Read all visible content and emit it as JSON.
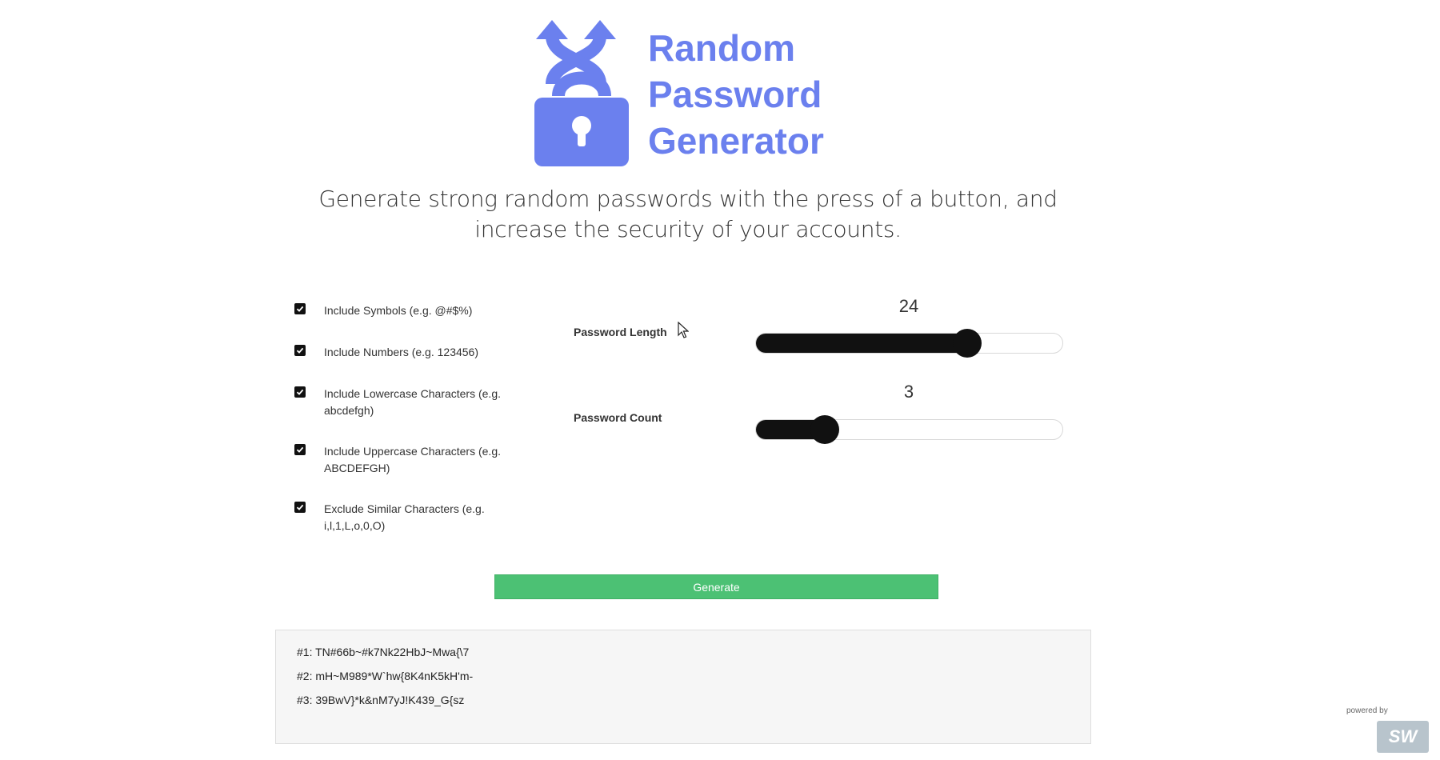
{
  "logo": {
    "line1": "Random",
    "line2": "Password",
    "line3": "Generator",
    "icon": "lock-shuffle-icon",
    "color": "#6b80ee"
  },
  "tagline": "Generate strong random passwords with the press of a button, and increase the security of your accounts.",
  "options": [
    {
      "label": "Include Symbols (e.g. @#$%)",
      "checked": true
    },
    {
      "label": "Include Numbers (e.g. 123456)",
      "checked": true
    },
    {
      "label": "Include Lowercase Characters (e.g. abcdefgh)",
      "checked": true
    },
    {
      "label": "Include Uppercase Characters (e.g. ABCDEFGH)",
      "checked": true
    },
    {
      "label": "Exclude Similar Characters (e.g. i,l,1,L,o,0,O)",
      "checked": true
    }
  ],
  "sliders": {
    "length": {
      "label": "Password Length",
      "value": "24",
      "fraction": 0.69
    },
    "count": {
      "label": "Password Count",
      "value": "3",
      "fraction": 0.225
    }
  },
  "generate_label": "Generate",
  "results": [
    "#1: TN#66b~#k7Nk22HbJ~Mwa{\\7",
    "#2: mH~M989*W`hw{8K4nK5kH'm-",
    "#3: 39BwV}*k&nM7yJ!K439_G{sz"
  ],
  "footer": {
    "powered_by": "powered by",
    "badge": "SW"
  },
  "colors": {
    "accent": "#6b80ee",
    "generate": "#4cc174",
    "slider": "#111111"
  }
}
